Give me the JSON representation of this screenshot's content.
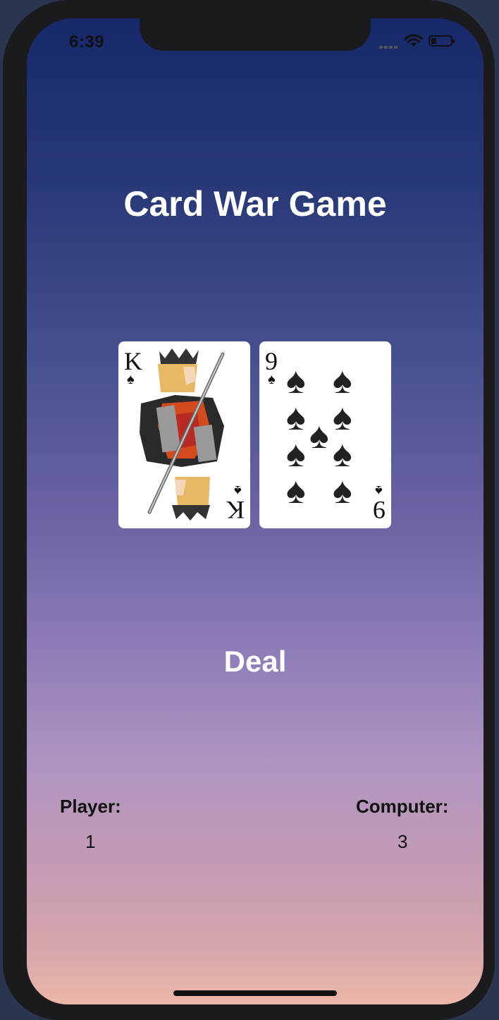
{
  "status_bar": {
    "time": "6:39",
    "wifi_icon": "wifi-icon",
    "battery_icon": "battery-icon"
  },
  "title": "Card War Game",
  "cards": {
    "player": {
      "rank": "K",
      "suit": "♠",
      "description": "King of Spades"
    },
    "computer": {
      "rank": "9",
      "suit": "♠",
      "description": "Nine of Spades"
    }
  },
  "deal_button": {
    "label": "Deal"
  },
  "scores": {
    "player_label": "Player:",
    "player_value": "1",
    "computer_label": "Computer:",
    "computer_value": "3"
  },
  "colors": {
    "gradient_top": "#17286a",
    "gradient_bottom": "#edb7a8",
    "text_light": "#ffffff",
    "text_dark": "#111111"
  }
}
